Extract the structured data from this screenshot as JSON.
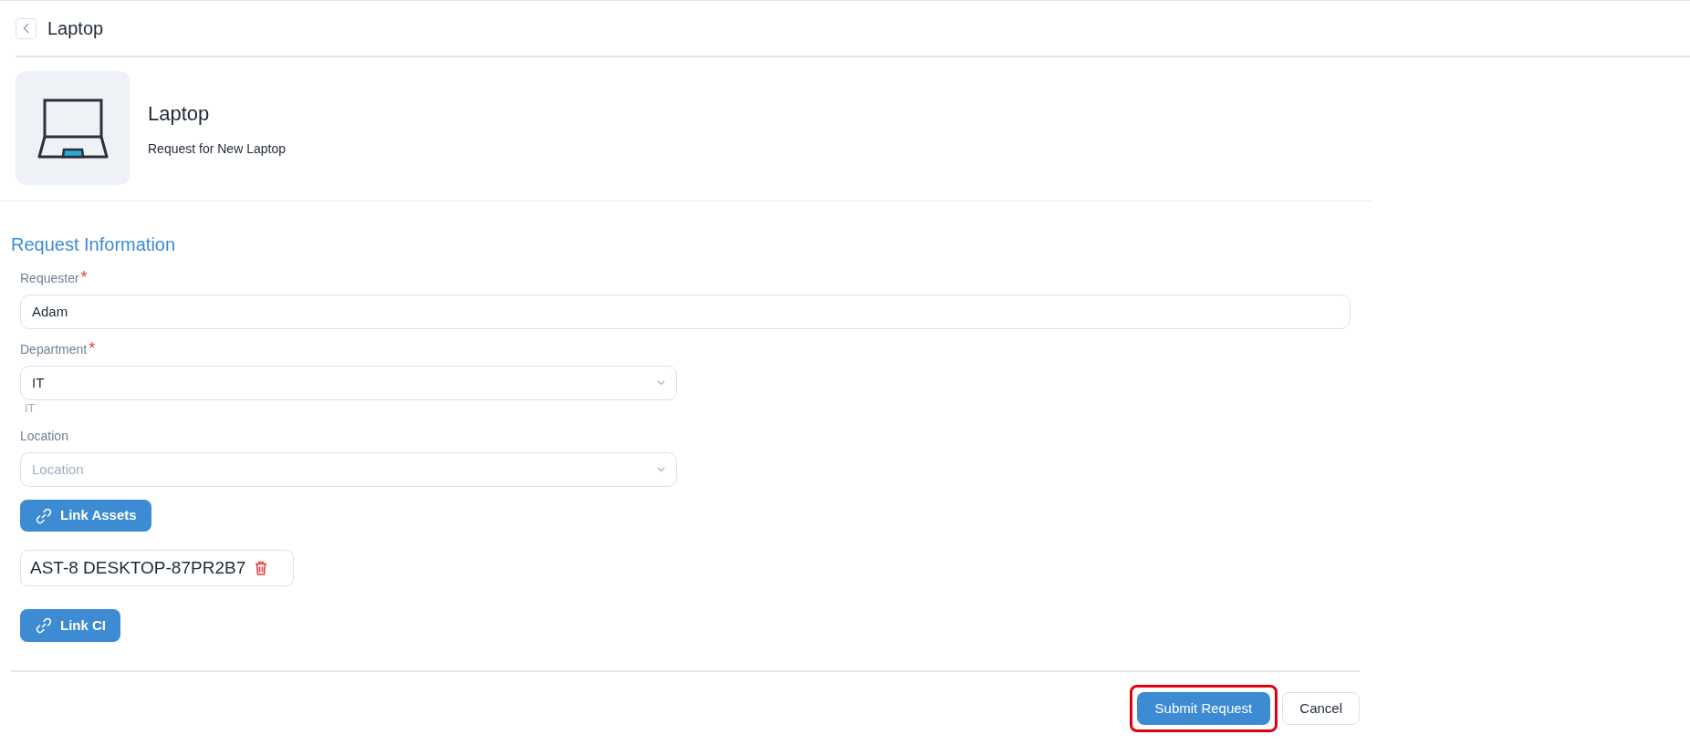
{
  "header": {
    "title": "Laptop"
  },
  "item": {
    "title": "Laptop",
    "description": "Request for New Laptop"
  },
  "section": {
    "title": "Request Information"
  },
  "fields": [
    {
      "kind": "text",
      "label": "Requester",
      "required_mark": "*",
      "value": "Adam"
    },
    {
      "kind": "select",
      "label": "Department",
      "required_mark": "*",
      "value": "IT",
      "hint": "IT"
    },
    {
      "kind": "select",
      "label": "Location",
      "placeholder": "Location"
    }
  ],
  "link_assets": {
    "label": "Link Assets"
  },
  "assets": [
    {
      "label": "AST-8 DESKTOP-87PR2B7"
    }
  ],
  "link_ci": {
    "label": "Link CI"
  },
  "actions": [
    {
      "kind": "primary",
      "label": "Submit Request",
      "highlighted": true
    },
    {
      "kind": "secondary",
      "label": "Cancel",
      "highlighted": false
    }
  ]
}
